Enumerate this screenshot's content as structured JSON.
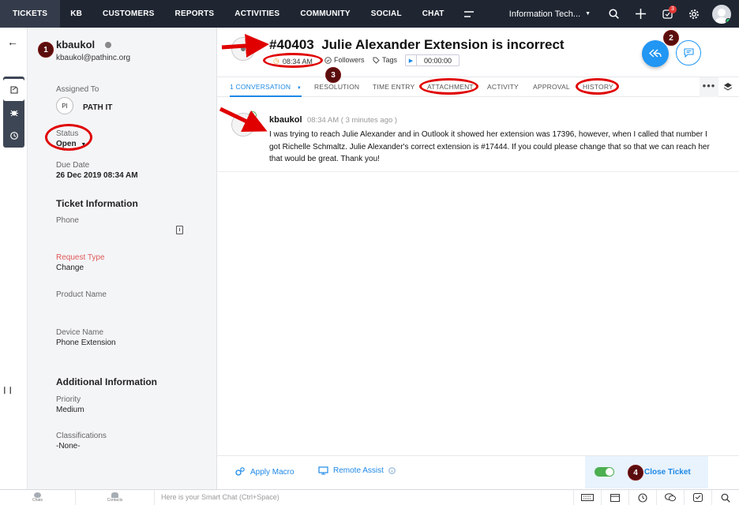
{
  "nav": {
    "tabs": [
      {
        "label": "TICKETS"
      },
      {
        "label": "KB"
      },
      {
        "label": "CUSTOMERS"
      },
      {
        "label": "REPORTS"
      },
      {
        "label": "ACTIVITIES"
      },
      {
        "label": "COMMUNITY"
      },
      {
        "label": "SOCIAL"
      },
      {
        "label": "CHAT"
      }
    ],
    "department": "Information Tech...",
    "notification_count": "3"
  },
  "panel": {
    "contact_name": "kbaukol",
    "contact_email": "kbaukol@pathinc.org",
    "assigned_to_label": "Assigned To",
    "assignee_initials": "PI",
    "assignee_name": "PATH IT",
    "status_label": "Status",
    "status_value": "Open",
    "due_date_label": "Due Date",
    "due_date_value": "26 Dec 2019 08:34 AM",
    "ticket_info_heading": "Ticket Information",
    "phone_label": "Phone",
    "request_type_label": "Request Type",
    "request_type_value": "Change",
    "product_name_label": "Product Name",
    "device_name_label": "Device Name",
    "device_name_value": "Phone Extension",
    "additional_info_heading": "Additional Information",
    "priority_label": "Priority",
    "priority_value": "Medium",
    "classifications_label": "Classifications",
    "classifications_value": "-None-"
  },
  "ticket": {
    "number": "#40403",
    "subject": "Julie Alexander Extension is incorrect",
    "time": "08:34 AM",
    "followers_label": "Followers",
    "tags_label": "Tags",
    "timer_value": "00:00:00"
  },
  "tabs": [
    {
      "label": "1 CONVERSATION"
    },
    {
      "label": "RESOLUTION"
    },
    {
      "label": "TIME ENTRY"
    },
    {
      "label": "ATTACHMENT"
    },
    {
      "label": "ACTIVITY"
    },
    {
      "label": "APPROVAL"
    },
    {
      "label": "HISTORY"
    }
  ],
  "conversation": {
    "author": "kbaukol",
    "time": "08:34 AM ( 3 minutes ago )",
    "body": "I was trying to reach Julie Alexander and in Outlook it showed her extension was 17396, however, when I called that number I got Richelle Schmaltz.    Julie Alexander's correct extension is #17444.  If you could please change that so that we can reach her that would be great.  Thank you!"
  },
  "actions": {
    "apply_macro": "Apply Macro",
    "remote_assist": "Remote Assist",
    "close_ticket": "Close Ticket"
  },
  "bottombar": {
    "chats_label": "Chats",
    "contacts_label": "Contacts",
    "smart_chat_placeholder": "Here is your Smart Chat (Ctrl+Space)"
  },
  "annotations": [
    "1",
    "2",
    "3",
    "4"
  ],
  "colors": {
    "topbar": "#1f2632",
    "accent": "#1e88e5",
    "annotation_red": "#e00000",
    "annotation_marker": "#5a0d0d"
  }
}
